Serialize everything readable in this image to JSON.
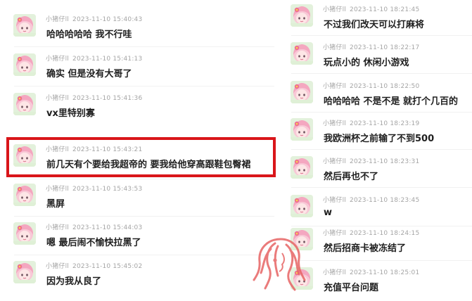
{
  "username": "小猪仔ll",
  "left_messages": [
    {
      "date": "2023-11-10 15:40:43",
      "text": "哈哈哈哈哈  我不行哇"
    },
    {
      "date": "2023-11-10 15:41:13",
      "text": "确实  但是没有大哥了"
    },
    {
      "date": "2023-11-10 15:41:36",
      "text": "vx里特别寡"
    },
    {
      "date": "2023-11-10 15:43:21",
      "text": "前几天有个要给我超帝的  要我给他穿高跟鞋包臀裙"
    },
    {
      "date": "2023-11-10 15:43:53",
      "text": "黑屏"
    },
    {
      "date": "2023-11-10 15:44:03",
      "text": "嗯  最后闹不愉快拉黑了"
    },
    {
      "date": "2023-11-10 15:45:02",
      "text": "因为我从良了"
    }
  ],
  "right_messages": [
    {
      "date": "2023-11-10 18:21:45",
      "text": "不过我们改天可以打麻将"
    },
    {
      "date": "2023-11-10 18:22:17",
      "text": "玩点小的  休闲小游戏"
    },
    {
      "date": "2023-11-10 18:22:50",
      "text": "哈哈哈哈  不是不是  就打个几百的"
    },
    {
      "date": "2023-11-10 18:23:19",
      "text": "我欧洲杯之前输了不到500"
    },
    {
      "date": "2023-11-10 18:23:31",
      "text": "然后再也不了"
    },
    {
      "date": "2023-11-10 18:23:45",
      "text": "w"
    },
    {
      "date": "2023-11-10 18:24:15",
      "text": "然后招商卡被冻结了"
    },
    {
      "date": "2023-11-10 18:25:01",
      "text": "充值平台问题"
    }
  ],
  "highlight_color": "#d9151a",
  "avatar_icon": "pink-hair-girl-avatar-icon",
  "watermark_icon": "woman-profile-watermark-icon"
}
